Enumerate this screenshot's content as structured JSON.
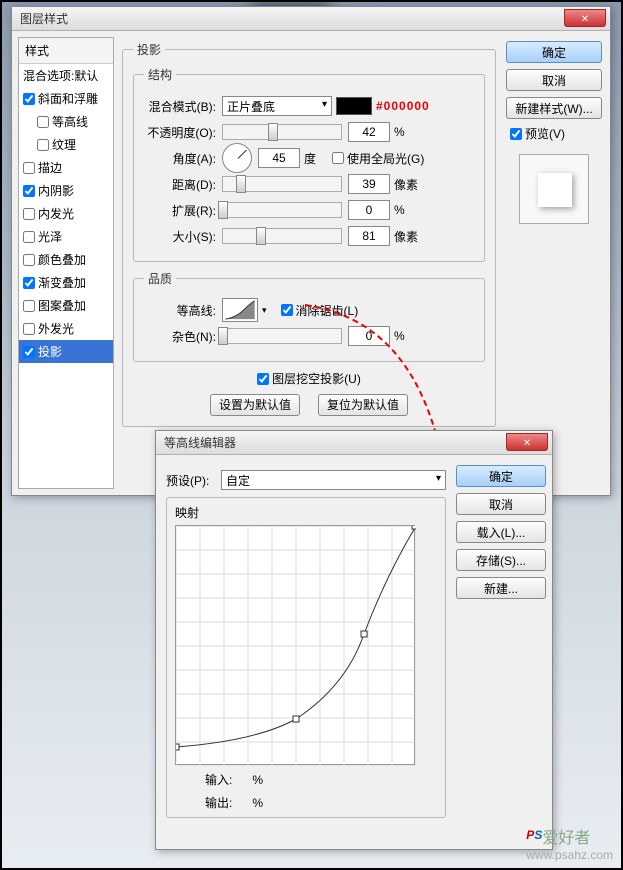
{
  "dialog1": {
    "title": "图层样式",
    "styles_header": "样式",
    "blend_options": "混合选项:默认",
    "items": [
      {
        "label": "斜面和浮雕",
        "checked": true,
        "sub": false
      },
      {
        "label": "等高线",
        "checked": false,
        "sub": true
      },
      {
        "label": "纹理",
        "checked": false,
        "sub": true
      },
      {
        "label": "描边",
        "checked": false,
        "sub": false
      },
      {
        "label": "内阴影",
        "checked": true,
        "sub": false
      },
      {
        "label": "内发光",
        "checked": false,
        "sub": false
      },
      {
        "label": "光泽",
        "checked": false,
        "sub": false
      },
      {
        "label": "颜色叠加",
        "checked": false,
        "sub": false
      },
      {
        "label": "渐变叠加",
        "checked": true,
        "sub": false
      },
      {
        "label": "图案叠加",
        "checked": false,
        "sub": false
      },
      {
        "label": "外发光",
        "checked": false,
        "sub": false
      },
      {
        "label": "投影",
        "checked": true,
        "sub": false,
        "selected": true
      }
    ],
    "group_shadow": "投影",
    "group_structure": "结构",
    "blend_mode_label": "混合模式(B):",
    "blend_mode_value": "正片叠底",
    "color_hex": "#000000",
    "opacity_label": "不透明度(O):",
    "opacity_value": "42",
    "opacity_unit": "%",
    "angle_label": "角度(A):",
    "angle_value": "45",
    "angle_unit": "度",
    "global_light": "使用全局光(G)",
    "distance_label": "距离(D):",
    "distance_value": "39",
    "distance_unit": "像素",
    "spread_label": "扩展(R):",
    "spread_value": "0",
    "spread_unit": "%",
    "size_label": "大小(S):",
    "size_value": "81",
    "size_unit": "像素",
    "group_quality": "品质",
    "contour_label": "等高线:",
    "antialias": "消除锯齿(L)",
    "noise_label": "杂色(N):",
    "noise_value": "0",
    "noise_unit": "%",
    "knockout": "图层挖空投影(U)",
    "make_default": "设置为默认值",
    "reset_default": "复位为默认值",
    "ok": "确定",
    "cancel": "取消",
    "new_style": "新建样式(W)...",
    "preview": "预览(V)"
  },
  "dialog2": {
    "title": "等高线编辑器",
    "preset_label": "预设(P):",
    "preset_value": "自定",
    "mapping": "映射",
    "input_label": "输入:",
    "output_label": "输出:",
    "percent": "%",
    "ok": "确定",
    "cancel": "取消",
    "load": "载入(L)...",
    "save": "存储(S)...",
    "new": "新建..."
  },
  "watermark": {
    "cn": "爱好者",
    "url": "www.psahz.com"
  },
  "chart_data": {
    "type": "line",
    "title": "映射",
    "xlabel": "输入",
    "ylabel": "输出",
    "xlim": [
      0,
      255
    ],
    "ylim": [
      0,
      255
    ],
    "points": [
      {
        "x": 0,
        "y": 20
      },
      {
        "x": 128,
        "y": 50
      },
      {
        "x": 200,
        "y": 140
      },
      {
        "x": 255,
        "y": 255
      }
    ]
  }
}
